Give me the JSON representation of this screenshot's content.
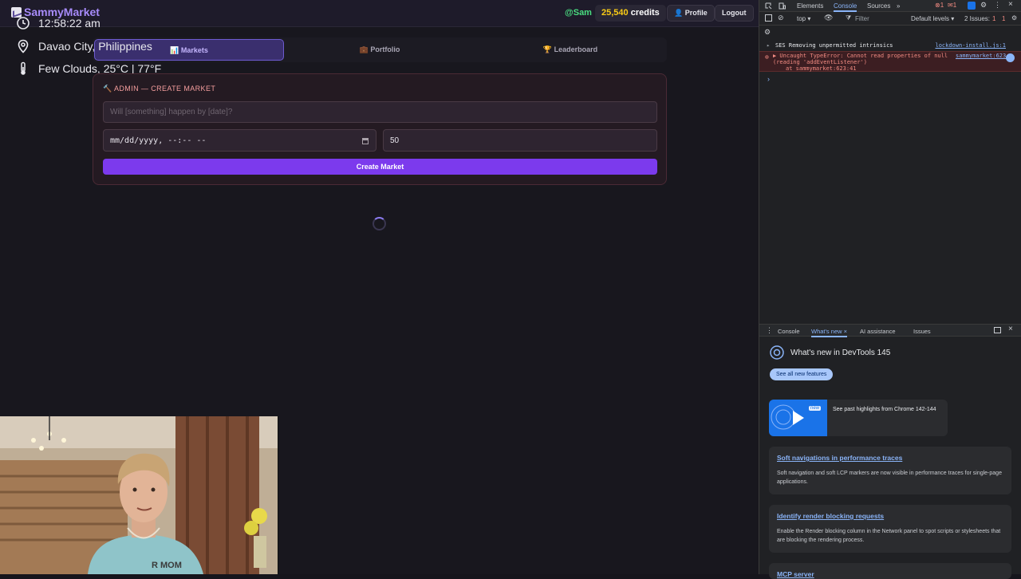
{
  "app": {
    "name": "SammyMarket",
    "user_handle": "@Sam",
    "credits_value": "25,540",
    "credits_suffix": " credits",
    "profile_label": "👤 Profile",
    "logout_label": "Logout"
  },
  "overlay": {
    "time": "12:58:22 am",
    "location": "Davao City, Philippines",
    "weather": "Few Clouds, 25°C | 77°F"
  },
  "tabs": [
    {
      "label": "📊 Markets",
      "active": true
    },
    {
      "label": "💼 Portfolio",
      "active": false
    },
    {
      "label": "🏆 Leaderboard",
      "active": false
    }
  ],
  "admin": {
    "title": "🔨 ADMIN — CREATE MARKET",
    "question_placeholder": "Will [something] happen by [date]?",
    "date_value": "mm/dd/yyyy, --:-- --",
    "number_value": "50",
    "create_label": "Create Market"
  },
  "devtools": {
    "tabs": [
      "Elements",
      "Console",
      "Sources",
      "»"
    ],
    "active_tab": "Console",
    "error_count": "1",
    "warn_count": "1",
    "context": "top ▾",
    "filter_placeholder": "Filter",
    "levels": "Default levels ▾",
    "issues": "2 Issues:",
    "issues_err": "1",
    "issues_warn": "1",
    "console": {
      "ses_line": "SES Removing unpermitted intrinsics",
      "ses_link": "lockdown-install.js:1",
      "error_line1": "▶ Uncaught TypeError: Cannot read properties of null",
      "error_line2": "(reading 'addEventListener')",
      "error_line3": "at sammymarket:623:41",
      "error_link": "sammymarket:623",
      "prompt": "›"
    },
    "drawer_tabs": [
      "Console",
      "What's new ×",
      "AI assistance",
      "Issues"
    ],
    "whats_new": {
      "title": "What's new in DevTools 145",
      "button": "See all new features",
      "highlight_badge": "new",
      "highlight_text": "See past highlights from Chrome 142-144",
      "cards": [
        {
          "title": "Soft navigations in performance traces",
          "body": "Soft navigation and soft LCP markers are now visible in performance traces for single-page applications."
        },
        {
          "title": "Identify render blocking requests",
          "body": "Enable the Render blocking column in the Network panel to spot scripts or stylesheets that are blocking the rendering process."
        },
        {
          "title": "MCP server",
          "body": ""
        }
      ]
    }
  },
  "webcam_caption": "R MOM"
}
